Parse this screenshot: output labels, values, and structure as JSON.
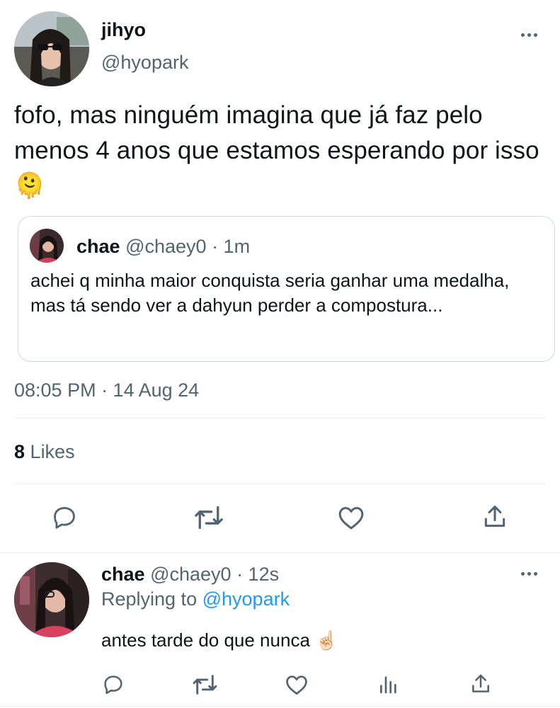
{
  "tweet": {
    "author_name": "jihyo",
    "author_handle": "@hyopark",
    "text": "fofo, mas ninguém imagina que já faz pelo menos 4 anos que estamos esperando por isso",
    "emoji": "🫠",
    "timestamp": "08:05 PM · 14 Aug 24",
    "likes_count": "8",
    "likes_label": "Likes"
  },
  "quote": {
    "author_name": "chae",
    "author_handle": "@chaey0",
    "time": "· 1m",
    "text": "achei q minha maior conquista seria ganhar uma medalha, mas tá sendo ver a dahyun perder a compostura..."
  },
  "reply": {
    "author_name": "chae",
    "author_handle": "@chaey0",
    "time": "· 12s",
    "replying_prefix": "Replying to",
    "replying_handle": "@hyopark",
    "text": "antes tarde do que nunca",
    "emoji": "☝🏻"
  },
  "icons": {
    "reply": "reply-icon",
    "retweet": "retweet-icon",
    "like": "heart-icon",
    "share": "share-icon",
    "analytics": "analytics-icon",
    "more": "more-icon"
  },
  "colors": {
    "text": "#0f1419",
    "secondary": "#536471",
    "link": "#1d9bf0",
    "divider": "#e6ecf0"
  }
}
